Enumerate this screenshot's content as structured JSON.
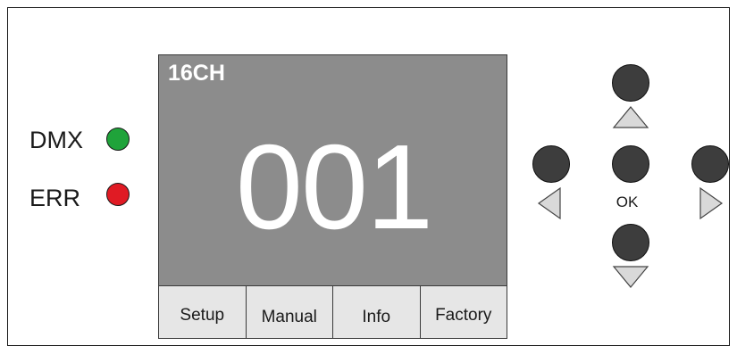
{
  "indicators": {
    "dmx": {
      "label": "DMX",
      "color": "#1fa33a"
    },
    "err": {
      "label": "ERR",
      "color": "#e01b24"
    }
  },
  "display": {
    "mode": "16CH",
    "value": "001",
    "background": "#8c8c8c"
  },
  "menu": {
    "items": [
      {
        "label": "Setup"
      },
      {
        "label": "Manual"
      },
      {
        "label": "Info"
      },
      {
        "label": "Factory"
      }
    ]
  },
  "controls": {
    "ok_label": "OK",
    "button_color": "#3d3d3d",
    "arrow_color": "#d9d9d9"
  }
}
